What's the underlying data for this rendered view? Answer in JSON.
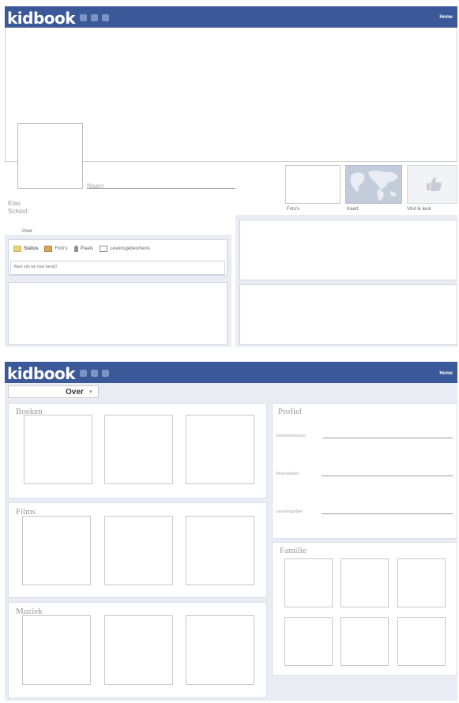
{
  "page1": {
    "logo": "kidbook",
    "home_link": "Home",
    "profile_name_label": "Naam",
    "info_lines": [
      "Klas:",
      "School:"
    ],
    "over_link": "Over",
    "thumbs": [
      {
        "label": "Foto's"
      },
      {
        "label": "Kaart"
      },
      {
        "label": "Vind ik leuk"
      }
    ],
    "composer_tabs": [
      "Status",
      "Foto's",
      "Plaats",
      "Levensgebeurtenis"
    ],
    "composer_placeholder": "Waar zijn we mee bezig?"
  },
  "page2": {
    "logo": "kidbook",
    "home_link": "Home",
    "over_tab": "Over",
    "sections": {
      "boeken": "Boeken",
      "films": "Films",
      "muziek": "Muziek",
      "profiel": "Profiel",
      "familie": "Familie"
    },
    "profile_fields": [
      "Geboortedatum",
      "Woonplaats",
      "Lievelingsdier"
    ]
  },
  "colors": {
    "topbar": "#3b5998",
    "topbar_icons": "#7c93c4",
    "panel_bg": "#e9ecf3"
  },
  "icons": [
    "friends-icon",
    "messages-icon",
    "notifications-icon",
    "status-icon",
    "photo-icon",
    "place-icon",
    "life-event-icon",
    "like-icon",
    "world-map-icon"
  ]
}
